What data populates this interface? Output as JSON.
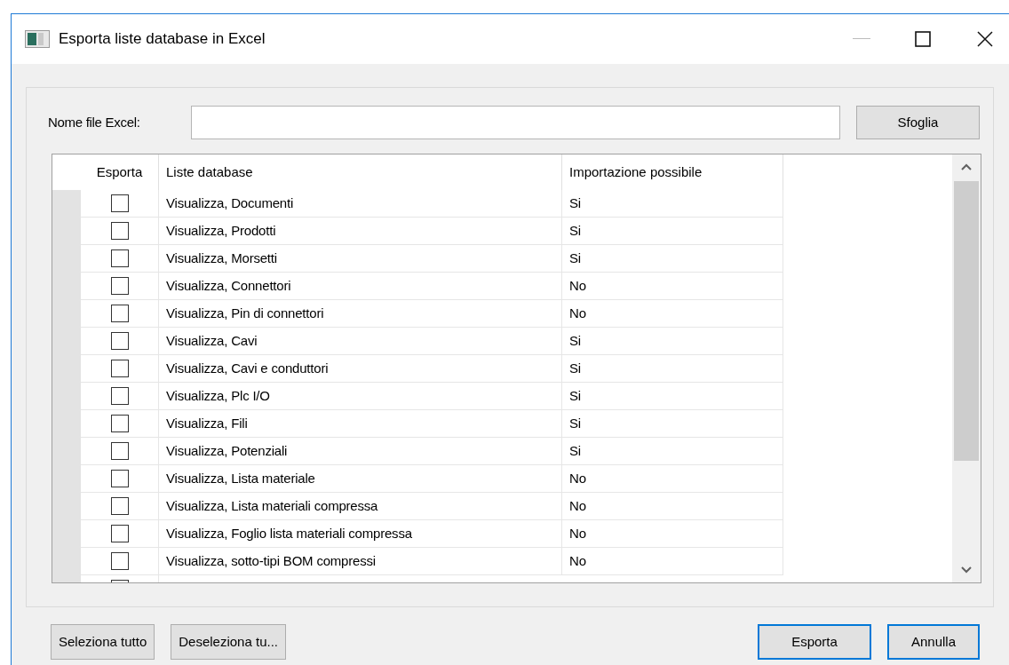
{
  "window": {
    "title": "Esporta liste database in Excel"
  },
  "file_field": {
    "label": "Nome file Excel:"
  },
  "browse_button": "Sfoglia",
  "table": {
    "columns": [
      "Esporta",
      "Liste database",
      "Importazione possibile"
    ],
    "rows": [
      {
        "checked": false,
        "list": "Visualizza, Documenti",
        "import": "Si"
      },
      {
        "checked": false,
        "list": "Visualizza, Prodotti",
        "import": "Si"
      },
      {
        "checked": false,
        "list": "Visualizza, Morsetti",
        "import": "Si"
      },
      {
        "checked": false,
        "list": "Visualizza, Connettori",
        "import": "No"
      },
      {
        "checked": false,
        "list": "Visualizza, Pin di connettori",
        "import": "No"
      },
      {
        "checked": false,
        "list": "Visualizza, Cavi",
        "import": "Si"
      },
      {
        "checked": false,
        "list": "Visualizza, Cavi e conduttori",
        "import": "Si"
      },
      {
        "checked": false,
        "list": "Visualizza, Plc I/O",
        "import": "Si"
      },
      {
        "checked": false,
        "list": "Visualizza, Fili",
        "import": "Si"
      },
      {
        "checked": false,
        "list": "Visualizza, Potenziali",
        "import": "Si"
      },
      {
        "checked": false,
        "list": "Visualizza, Lista materiale",
        "import": "No"
      },
      {
        "checked": false,
        "list": "Visualizza, Lista materiali compressa",
        "import": "No"
      },
      {
        "checked": false,
        "list": "Visualizza, Foglio lista materiali compressa",
        "import": "No"
      },
      {
        "checked": false,
        "list": "Visualizza, sotto-tipi BOM compressi",
        "import": "No"
      },
      {
        "kind": "cut",
        "checked": false
      }
    ]
  },
  "buttons": [
    {
      "label": "Seleziona tutto",
      "kind": "left"
    },
    {
      "label": "Deseleziona tu...",
      "kind": "left"
    },
    {
      "label": "Esporta",
      "kind": "right"
    },
    {
      "label": "Annulla",
      "kind": "right"
    }
  ]
}
